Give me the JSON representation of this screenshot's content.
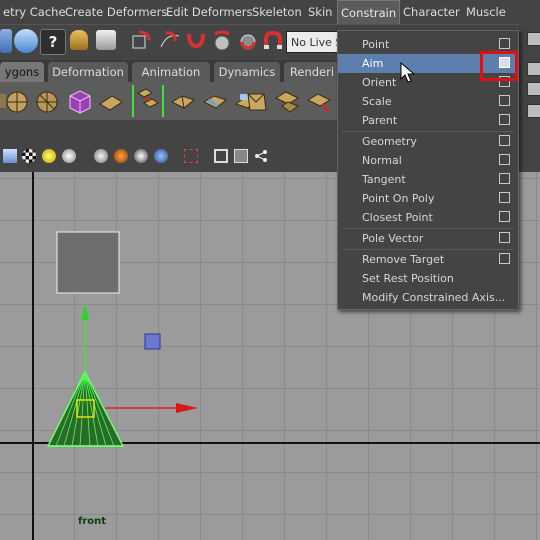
{
  "menubar": {
    "items": [
      "etry Cache",
      "Create Deformers",
      "Edit Deformers",
      "Skeleton",
      "Skin",
      "Constrain",
      "Character",
      "Muscle"
    ],
    "active": "Constrain"
  },
  "statusline": {
    "live_field": "No Live S"
  },
  "shelf_tabs": {
    "items": [
      "ygons",
      "Deformation",
      "Animation",
      "Dynamics",
      "Renderi"
    ],
    "active": "ygons"
  },
  "viewport": {
    "label": "front"
  },
  "constrain_menu": {
    "items": [
      {
        "label": "Point",
        "option_box": true
      },
      {
        "label": "Aim",
        "option_box": true,
        "highlighted": true
      },
      {
        "label": "Orient",
        "option_box": true
      },
      {
        "label": "Scale",
        "option_box": true
      },
      {
        "label": "Parent",
        "option_box": true
      },
      {
        "label": "Geometry",
        "option_box": true
      },
      {
        "label": "Normal",
        "option_box": true
      },
      {
        "label": "Tangent",
        "option_box": true
      },
      {
        "label": "Point On Poly",
        "option_box": true
      },
      {
        "label": "Closest Point",
        "option_box": true
      },
      {
        "label": "Pole Vector",
        "option_box": true
      },
      {
        "label": "Remove Target",
        "option_box": true
      },
      {
        "label": "Set Rest Position",
        "option_box": false
      },
      {
        "label": "Modify Constrained Axis...",
        "option_box": false
      }
    ]
  },
  "colors": {
    "menu_bg": "#444444",
    "highlight": "#5d7fae",
    "annotation_red": "#e01010",
    "cone_green": "#4cff4c",
    "axis_red": "#e02020"
  }
}
